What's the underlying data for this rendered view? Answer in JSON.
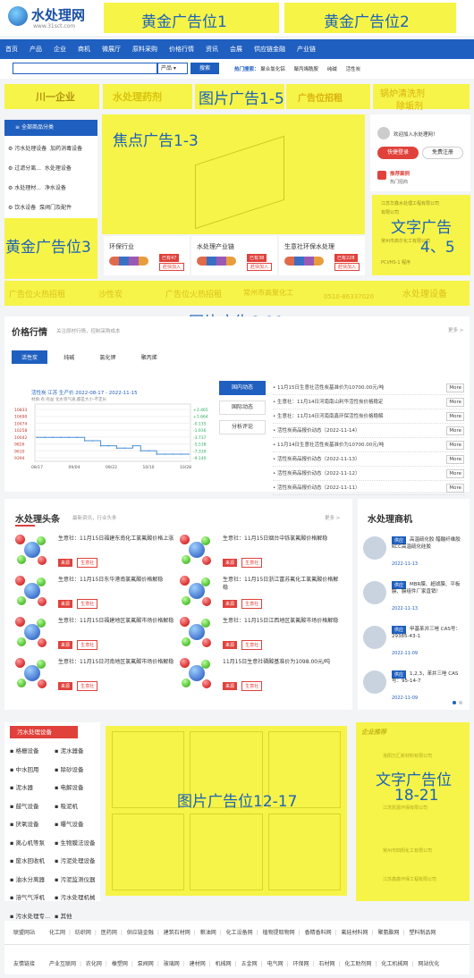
{
  "brand": {
    "name": "水处理网",
    "url": "www.31sct.com"
  },
  "ads": {
    "gold_1_2": "黄金广告位1",
    "gold_2": "黄金广告位2",
    "img_1_5": "图片广告1-5",
    "focus": "焦点广告1-3",
    "gold_3": "黄金广告位3",
    "text_4_5": "文字广告",
    "text_4_5_num": "4、5",
    "img_6_11": "图片广告6-11",
    "img_12_17": "图片广告位12-17",
    "text_18_21_a": "文字广告位",
    "text_18_21_b": "18-21"
  },
  "nav": {
    "items": [
      "首页",
      "产品",
      "企业",
      "商机",
      "微展厅",
      "原料采购",
      "价格行情",
      "资讯",
      "会展",
      "供应链金融",
      "产业链"
    ]
  },
  "search": {
    "placeholder": "",
    "select": "产品",
    "button": "搜索",
    "hot_label": "热门搜索：",
    "hot": [
      "聚合氯化铝",
      "聚丙烯酰胺",
      "纯碱",
      "活性炭"
    ]
  },
  "banner_ads": {
    "a": "川一企业",
    "b": "水处理药剂",
    "c": "广告位招租",
    "d": "锅炉清洗剂",
    "d2": "除垢剂"
  },
  "category": {
    "title": "全部商品分类",
    "items": [
      {
        "a": "污水处理设备",
        "b": "加药消毒设备"
      },
      {
        "a": "过滤分离...",
        "b": "水处理设备"
      },
      {
        "a": "水处理材...",
        "b": "净水设备"
      },
      {
        "a": "饮水设备",
        "b": "泵阀门及配件"
      }
    ]
  },
  "industry": {
    "items": [
      {
        "name": "环保行业",
        "count": "已有47",
        "join": "赶快加入"
      },
      {
        "name": "水处理产业链",
        "count": "已有38",
        "join": "赶快加入"
      },
      {
        "name": "生意社环保水处理",
        "count": "已有228",
        "join": "赶快加入"
      }
    ]
  },
  "user": {
    "welcome": "欢迎加入水处理网！",
    "login": "快捷登录",
    "register": "免费注册",
    "recommend": "推荐案例",
    "recommend_sub": "热门招商"
  },
  "text_ads": [
    "江苏华鑫水处理工程有限公司",
    "有限公司",
    "常州市高尔化工有限公司",
    "PCI/HS-1 程序"
  ],
  "strip_ads": [
    "广告位火热招租",
    "沙性炭",
    "广告位火热招租",
    "常州市高聚化工",
    "0510-86337020",
    "水处理设备"
  ],
  "price": {
    "title": "价格行情",
    "subtitle": "关注原材行情，控制采购成本",
    "more": "更多 >",
    "tabs": [
      "活性炭",
      "纯碱",
      "氯化钾",
      "聚丙烯"
    ],
    "chart_title": "活性炭 江苏 生产价 2022-08-17 - 2022-11-15",
    "chart_sub": "材质:有:有益 化水等气质,都是大小-不定长",
    "side_tabs": [
      "国内动态",
      "国际动态",
      "分析评论"
    ],
    "news": [
      "11月15日生意社活性炭基准价为10700.00元/吨",
      "生意社：11月14日河南南山利华活性炭价格稳定",
      "生意社：11月14日河南南鑫环保活性炭价格稳解",
      "活性炭商品报价动态（2022-11-14）",
      "11月14日生意社活性炭基准价为10700.00元/吨",
      "活性炭商品报价动态（2022-11-13）",
      "活性炭商品报价动态（2022-11-12）",
      "活性炭商品报价动态（2022-11-11）"
    ],
    "more_label": "More"
  },
  "chart_data": {
    "type": "line",
    "title": "活性炭 江苏 生产价 2022-08-17 - 2022-11-15",
    "x": [
      "08/17",
      "09/04",
      "09/22",
      "10/10",
      "10/28"
    ],
    "y_left_ticks": [
      "10833",
      "10690",
      "10474",
      "10258",
      "10042",
      "9826",
      "9610",
      "9394"
    ],
    "y_right_ticks": [
      "+3.465",
      "+1.664",
      "-0.135",
      "-1.936",
      "-3.737",
      "-5.538",
      "-7.339",
      "-9.140"
    ],
    "series": [
      {
        "values": [
          10000,
          10000,
          10000,
          10000,
          10000,
          10000,
          9900,
          9900,
          9750,
          9750,
          9680,
          9680,
          9750,
          9600,
          9600,
          9500,
          9500,
          9500,
          9500,
          9500
        ]
      }
    ]
  },
  "headlines": {
    "title": "水处理头条",
    "subtitle": "最新资讯，行业头条",
    "more": "更多 >",
    "items": [
      {
        "text": "生意社：11月15日福建东南化工氯氟酸价格上涨",
        "tag1": "来源",
        "tag2": "生意社"
      },
      {
        "text": "生意社：11月15日烟台中铄氯氟酸价格解稳",
        "tag1": "来源",
        "tag2": "生意社"
      },
      {
        "text": "生意社：11月15日东华港南氯氟酸价格解稳",
        "tag1": "来源",
        "tag2": "生意社"
      },
      {
        "text": "生意社：11月15日浙江富苏氟化工氯氟酸价格解稳",
        "tag1": "来源",
        "tag2": "生意社"
      },
      {
        "text": "生意社：11月15日福建地区氯氟酸市场价格解稳",
        "tag1": "来源",
        "tag2": "生意社"
      },
      {
        "text": "生意社：11月15日江西地区氯氟酸市场价格解稳",
        "tag1": "来源",
        "tag2": "生意社"
      },
      {
        "text": "生意社：11月15日河南地区氯氟酸市场价格解稳",
        "tag1": "来源",
        "tag2": "生意社"
      },
      {
        "text": "11月15日生意社磷酸基准价为1098.00元/吨",
        "tag1": "来源",
        "tag2": "生意社"
      }
    ]
  },
  "business": {
    "title": "水处理商机",
    "items": [
      {
        "text": "高温硫化胶 醋酸纤维胶 KCC高温硫化硅胶",
        "tag": "供应",
        "date": "2022-11-13"
      },
      {
        "text": "MBR膜、超滤膜、平板膜、膜组件厂家直销！",
        "tag": "供应",
        "date": "2022-11-13"
      },
      {
        "text": "甲基苯并三唑 CAS号：29385-43-1",
        "tag": "供应",
        "date": "2022-11-09"
      },
      {
        "text": "1,2,3，苯并三唑 CAS号：95-14-7",
        "tag": "供应",
        "date": "2022-11-09"
      }
    ]
  },
  "equipment": {
    "title": "污水处理设备",
    "left": [
      "格栅设备",
      "中水回用",
      "泥水器",
      "鼓气设备",
      "厌氧设备",
      "离心机等泵",
      "废水回收机",
      "油水分离器",
      "溶气气浮机",
      "污水处理专..."
    ],
    "right": [
      "泥水器备",
      "除砂设备",
      "电解设备",
      "吸泥机",
      "曝气设备",
      "生物膜法设备",
      "污泥处理设备",
      "污泥监测仪器",
      "污水处理机械",
      "其他"
    ]
  },
  "company_recommend": {
    "title": "企业推荐",
    "items": [
      "洛阳万汇新材料有限公司",
      "江苏凯嘉环保有限公司",
      "常州市四阳化工有限公司",
      "江苏鑫鑫环保工程有限公司"
    ]
  },
  "footer": {
    "alliance_label": "联盟网站",
    "alliance": [
      "化工网",
      "纺织网",
      "医药网",
      "供应链金融",
      "建筑石材网",
      "粮油网",
      "化工设备网",
      "植物提取物网",
      "香精香料网",
      "氟硅材料网",
      "聚氨酯网",
      "塑料制品网"
    ],
    "links_label": "友情链接",
    "links": [
      "产业互联网",
      "农化网",
      "橡塑网",
      "泵阀网",
      "玻璃网",
      "建材网",
      "机械网",
      "五金网",
      "电气网",
      "环保网",
      "石材网",
      "化工助剂网",
      "化工机械网",
      "网站优化"
    ]
  }
}
